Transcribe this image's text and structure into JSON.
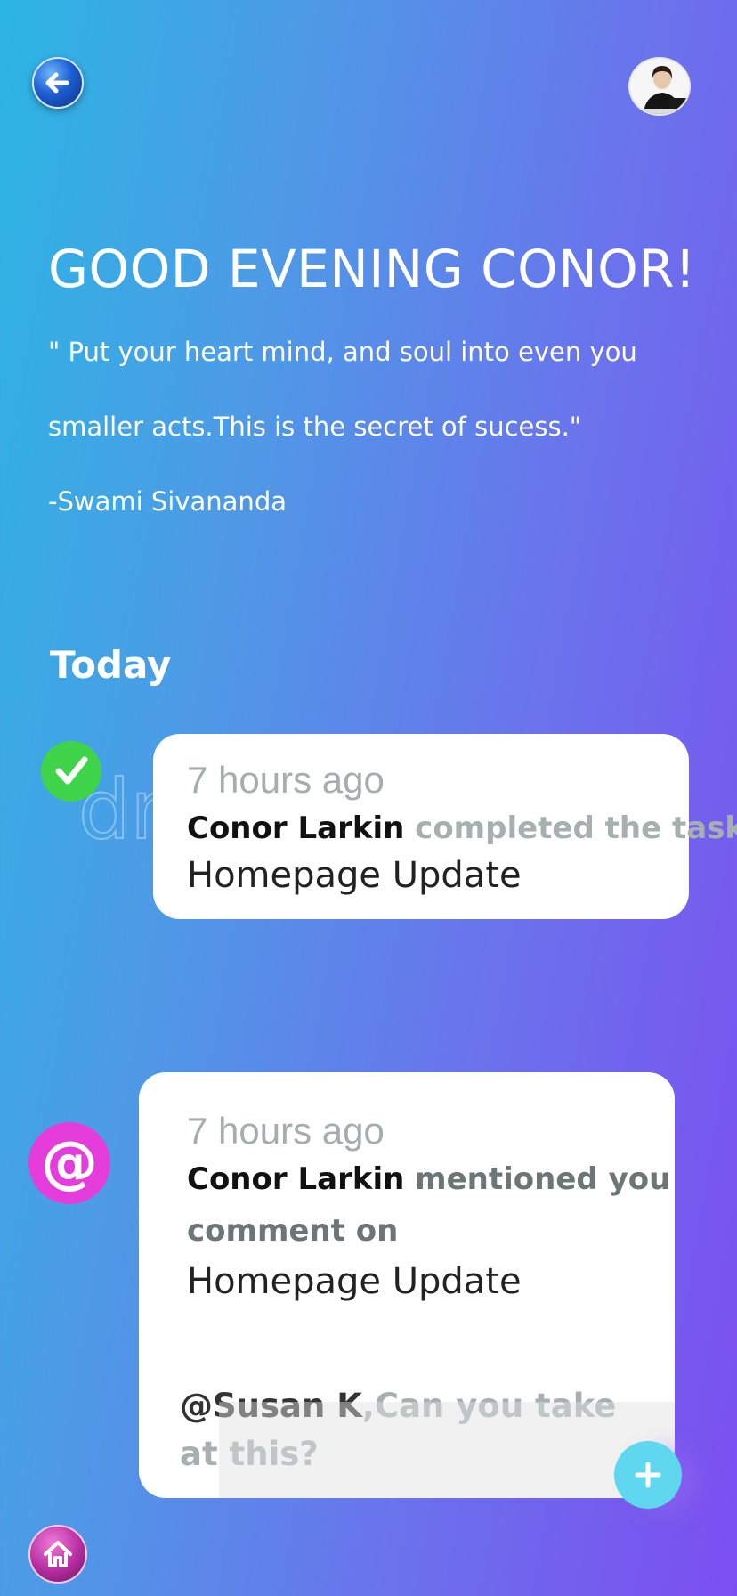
{
  "header": {
    "back_icon": "arrow-left-icon",
    "avatar_icon": "user-avatar"
  },
  "greeting": "GOOD EVENING CONOR!",
  "quote": {
    "line1": "\" Put your heart mind, and soul  into even you",
    "line2": " smaller acts.This is the secret of sucess.\"",
    "author": "-Swami Sivananda"
  },
  "section_title": "Today",
  "activities": [
    {
      "icon": "check-icon",
      "time": "7 hours ago",
      "actor": "Conor Larkin",
      "action": " completed the task",
      "task": "Homepage Update"
    },
    {
      "icon": "at-icon",
      "icon_glyph": "@",
      "time": "7 hours ago",
      "actor": "Conor Larkin",
      "action_line1": " mentioned you in a",
      "action_line2": "comment on",
      "task": "Homepage Update",
      "mention": "@Susan K",
      "comment": ",Can you take at this?"
    }
  ],
  "fab_icon": "plus-icon",
  "home_icon": "home-icon",
  "colors": {
    "check_badge": "#3fd44a",
    "at_badge": "#e53ddc",
    "fab": "#5fd7ef"
  }
}
